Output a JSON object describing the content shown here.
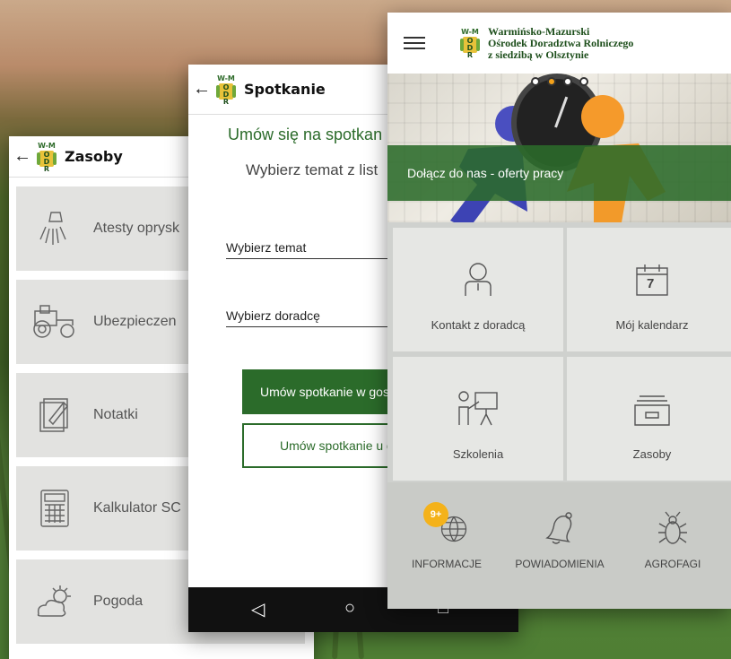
{
  "colors": {
    "brand_green": "#2b6b2a",
    "badge_yellow": "#f4b21a"
  },
  "zasoby": {
    "title": "Zasoby",
    "back_icon": "arrow-left-icon",
    "items": [
      {
        "label": "Atesty oprysk",
        "icon": "sprayer-icon"
      },
      {
        "label": "Ubezpieczen",
        "icon": "tractor-icon"
      },
      {
        "label": "Notatki",
        "icon": "notes-icon"
      },
      {
        "label": "Kalkulator SC",
        "icon": "calculator-icon"
      },
      {
        "label": "Pogoda",
        "icon": "weather-icon"
      }
    ]
  },
  "spotkanie": {
    "title": "Spotkanie",
    "heading": "Umów się na spotkan",
    "subheading": "Wybierz temat z list",
    "field_topic": "Wybierz temat",
    "field_advisor": "Wybierz doradcę",
    "button_primary": "Umów spotkanie w gos",
    "button_secondary": "Umów spotkanie u d",
    "nav": {
      "back": "◁",
      "home": "○",
      "recents": "□"
    }
  },
  "main": {
    "org_lines": [
      "Warmińsko-Mazurski",
      "Ośrodek Doradztwa Rolniczego",
      "z siedzibą w Olsztynie"
    ],
    "banner_label": "Dołącz do nas - oferty pracy",
    "carousel_active": 1,
    "carousel_count": 4,
    "tiles": [
      {
        "label": "Kontakt z doradcą",
        "icon": "person-icon"
      },
      {
        "label": "Mój kalendarz",
        "icon": "calendar-icon",
        "day": "7"
      },
      {
        "label": "Szkolenia",
        "icon": "presentation-icon"
      },
      {
        "label": "Zasoby",
        "icon": "archive-box-icon"
      }
    ],
    "bottom": [
      {
        "label": "INFORMACJE",
        "icon": "globe-icon",
        "badge": "9+"
      },
      {
        "label": "POWIADOMIENIA",
        "icon": "bell-icon"
      },
      {
        "label": "AGROFAGI",
        "icon": "bug-icon"
      }
    ]
  },
  "logo": {
    "top": "W-M",
    "letters": "ODR"
  }
}
